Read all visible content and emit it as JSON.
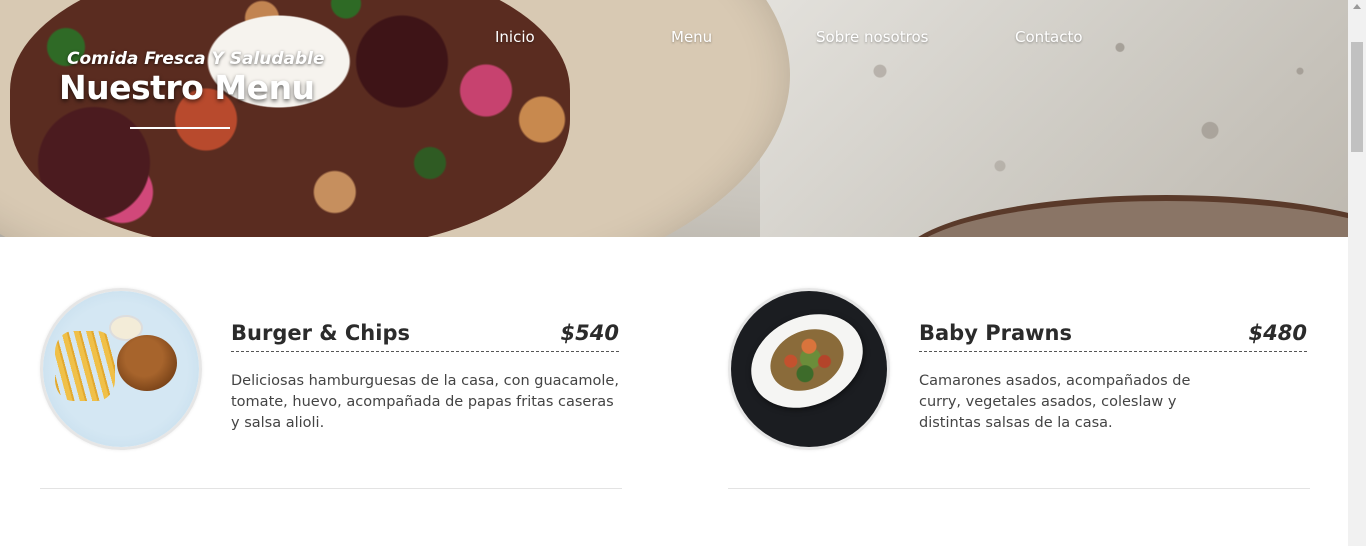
{
  "hero": {
    "subtitle": "Comida Fresca Y Saludable",
    "title": "Nuestro Menu"
  },
  "nav": {
    "items": [
      {
        "label": "Inicio"
      },
      {
        "label": "Menu"
      },
      {
        "label": "Sobre nosotros"
      },
      {
        "label": "Contacto"
      }
    ]
  },
  "menu": {
    "items": [
      {
        "name": "Burger & Chips",
        "price": "$540",
        "description": "Deliciosas hamburguesas de la casa, con guacamole, tomate, huevo, acompañada de papas fritas caseras y salsa alioli.",
        "image_icon": "burger-plate-icon"
      },
      {
        "name": "Baby Prawns",
        "price": "$480",
        "description": "Camarones asados, acompañados de curry, vegetales asados, coleslaw y distintas salsas de la casa.",
        "image_icon": "prawns-plate-icon"
      }
    ]
  },
  "colors": {
    "text_dark": "#2b2b2b",
    "text_body": "#444444",
    "nav_text": "#ffffff"
  }
}
